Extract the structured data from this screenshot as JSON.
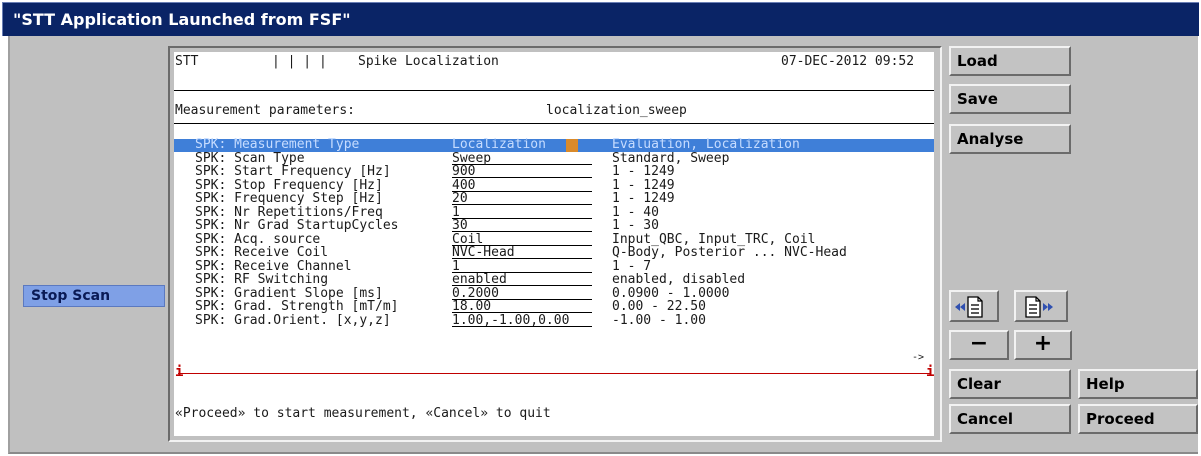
{
  "window": {
    "title": "\"STT Application Launched from FSF\""
  },
  "left": {
    "stop_scan_label": "Stop Scan"
  },
  "header": {
    "app": "STT",
    "separators": "| | | |",
    "screen_title": "Spike Localization",
    "datetime": "07-DEC-2012 09:52"
  },
  "measurement": {
    "label": "Measurement parameters:",
    "name": "localization_sweep"
  },
  "params": [
    {
      "name": "SPK: Measurement Type",
      "value": "Localization",
      "range": "Evaluation, Localization",
      "selected": true
    },
    {
      "name": "SPK: Scan Type",
      "value": "Sweep",
      "range": "Standard, Sweep"
    },
    {
      "name": "SPK: Start Frequency [Hz]",
      "value": "900",
      "range": "1 - 1249"
    },
    {
      "name": "SPK: Stop Frequency [Hz]",
      "value": "400",
      "range": "1 - 1249"
    },
    {
      "name": "SPK: Frequency Step [Hz]",
      "value": "20",
      "range": "1 - 1249"
    },
    {
      "name": "SPK: Nr Repetitions/Freq",
      "value": "1",
      "range": "1 - 40"
    },
    {
      "name": "SPK: Nr Grad StartupCycles",
      "value": "30",
      "range": "1 - 30"
    },
    {
      "name": "SPK: Acq. source",
      "value": "Coil",
      "range": "Input_QBC, Input_TRC, Coil"
    },
    {
      "name": "SPK: Receive Coil",
      "value": "NVC-Head",
      "range": "Q-Body, Posterior ... NVC-Head"
    },
    {
      "name": "SPK: Receive Channel",
      "value": "1",
      "range": "1 - 7"
    },
    {
      "name": "SPK: RF Switching",
      "value": "enabled",
      "range": "enabled, disabled"
    },
    {
      "name": "SPK: Gradient Slope [ms]",
      "value": "0.2000",
      "range": "0.0900 - 1.0000"
    },
    {
      "name": "SPK: Grad. Strength [mT/m]",
      "value": "18.00",
      "range": "0.00 - 22.50"
    },
    {
      "name": "SPK: Grad.Orient. [x,y,z]",
      "value": "1.00,-1.00,0.00",
      "range": "-1.00 - 1.00"
    }
  ],
  "scroll": {
    "marker_left": "i",
    "marker_right": "i",
    "arrow": "->"
  },
  "prompt": "«Proceed» to start measurement, «Cancel» to quit",
  "buttons": {
    "load": "Load",
    "save": "Save",
    "analyse": "Analyse",
    "minus": "−",
    "plus": "+",
    "clear": "Clear",
    "help": "Help",
    "cancel": "Cancel",
    "proceed": "Proceed"
  },
  "icons": {
    "page_prev": "page-previous-icon",
    "page_next": "page-next-icon"
  },
  "colors": {
    "title_bar": "#0a2466",
    "selection": "#3f7fd8",
    "stop_scan": "#7fa0e6",
    "cursor": "#d98a2b",
    "scroll_marker": "#c00000"
  }
}
